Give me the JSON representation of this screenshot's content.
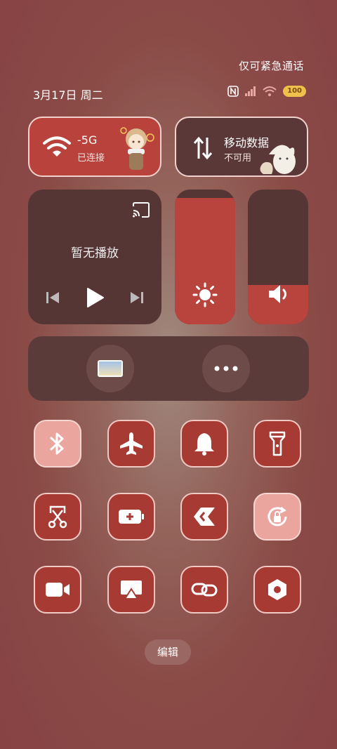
{
  "status": {
    "emergency_note": "仅可紧急通话",
    "date": "3月17日 周二",
    "battery": "100",
    "icons": [
      "nfc-icon",
      "signal-icon",
      "wifi-status-icon",
      "battery-icon"
    ]
  },
  "wifi": {
    "title": "-5G",
    "subtitle": "已连接"
  },
  "mobile_data": {
    "title": "移动数据",
    "subtitle": "不可用"
  },
  "media": {
    "title": "暂无播放"
  },
  "brightness": {
    "level": 0.94
  },
  "volume": {
    "level": 0.29
  },
  "toggles": [
    {
      "name": "bluetooth",
      "on": true
    },
    {
      "name": "airplane-mode",
      "on": false
    },
    {
      "name": "ring-mode",
      "on": false
    },
    {
      "name": "flashlight",
      "on": false
    },
    {
      "name": "screenshot",
      "on": false
    },
    {
      "name": "battery-saver",
      "on": false
    },
    {
      "name": "shortcuts",
      "on": false
    },
    {
      "name": "rotation-lock",
      "on": true
    },
    {
      "name": "screen-record",
      "on": false
    },
    {
      "name": "screen-cast",
      "on": false
    },
    {
      "name": "connect",
      "on": false
    },
    {
      "name": "settings",
      "on": false
    }
  ],
  "edit_label": "编辑",
  "colors": {
    "accent": "#b8443d",
    "on_tile": "#eba59f",
    "dark_card": "#553634"
  }
}
